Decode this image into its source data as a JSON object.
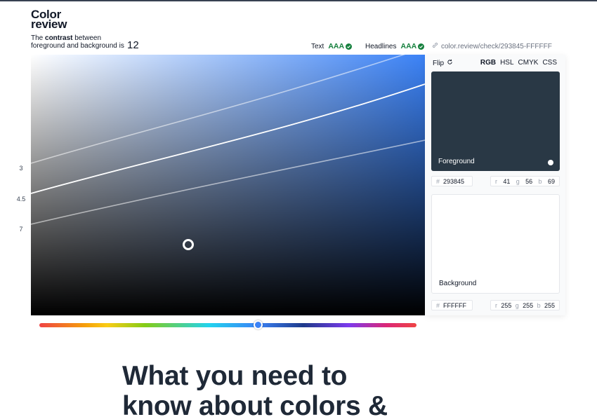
{
  "brand": {
    "logo_line1": "Color",
    "logo_line2": "review"
  },
  "contrast": {
    "prefix": "The ",
    "bold": "contrast",
    "suffix": " between",
    "line2": "foreground and background is",
    "value": "12"
  },
  "ratings": [
    {
      "label": "Text",
      "grade": "AAA"
    },
    {
      "label": "Headlines",
      "grade": "AAA"
    }
  ],
  "share_link": "color.review/check/293845-FFFFFF",
  "contrast_levels": [
    "3",
    "4.5",
    "7"
  ],
  "panel": {
    "flip_label": "Flip",
    "modes": [
      "RGB",
      "HSL",
      "CMYK",
      "CSS"
    ],
    "foreground": {
      "label": "Foreground",
      "hex": "293845",
      "r": "41",
      "g": "56",
      "b": "69",
      "color": "#293845"
    },
    "background": {
      "label": "Background",
      "hex": "FFFFFF",
      "r": "255",
      "g": "255",
      "b": "255",
      "color": "#FFFFFF"
    }
  },
  "headline": {
    "line1": "What you need to",
    "line2": "know about colors &"
  },
  "colors": {
    "accent": "#3b82f6",
    "pass": "#15803d",
    "text_dark": "#1f2937"
  }
}
